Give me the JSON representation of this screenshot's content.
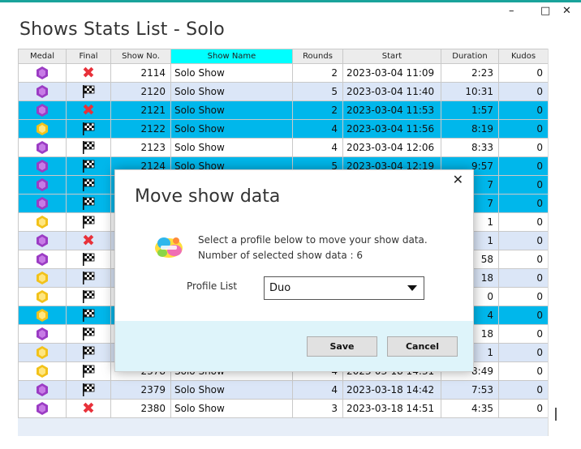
{
  "window": {
    "title": "Shows Stats List - Solo",
    "minimize_glyph": "–",
    "maximize_glyph": "□",
    "close_glyph": "✕"
  },
  "grid": {
    "columns": [
      "Medal",
      "Final",
      "Show No.",
      "Show Name",
      "Rounds",
      "Start",
      "Duration",
      "Kudos"
    ],
    "active_column": "Show Name",
    "rows": [
      {
        "medal": "purple",
        "final": "x",
        "show_no": "2114",
        "show_name": "Solo Show",
        "rounds": "2",
        "start": "2023-03-04 11:09",
        "duration": "2:23",
        "kudos": "0",
        "state": "white"
      },
      {
        "medal": "purple",
        "final": "flag",
        "show_no": "2120",
        "show_name": "Solo Show",
        "rounds": "5",
        "start": "2023-03-04 11:40",
        "duration": "10:31",
        "kudos": "0",
        "state": "alt"
      },
      {
        "medal": "purple",
        "final": "x",
        "show_no": "2121",
        "show_name": "Solo Show",
        "rounds": "2",
        "start": "2023-03-04 11:53",
        "duration": "1:57",
        "kudos": "0",
        "state": "sel"
      },
      {
        "medal": "gold",
        "final": "flag",
        "show_no": "2122",
        "show_name": "Solo Show",
        "rounds": "4",
        "start": "2023-03-04 11:56",
        "duration": "8:19",
        "kudos": "0",
        "state": "sel"
      },
      {
        "medal": "purple",
        "final": "flag",
        "show_no": "2123",
        "show_name": "Solo Show",
        "rounds": "4",
        "start": "2023-03-04 12:06",
        "duration": "8:33",
        "kudos": "0",
        "state": "white"
      },
      {
        "medal": "purple",
        "final": "flag",
        "show_no": "2124",
        "show_name": "Solo Show",
        "rounds": "5",
        "start": "2023-03-04 12:19",
        "duration": "9:57",
        "kudos": "0",
        "state": "sel"
      },
      {
        "medal": "purple",
        "final": "flag",
        "show_no": "",
        "show_name": "",
        "rounds": "",
        "start": "",
        "duration": "7",
        "kudos": "0",
        "state": "sel"
      },
      {
        "medal": "purple",
        "final": "flag",
        "show_no": "",
        "show_name": "",
        "rounds": "",
        "start": "",
        "duration": "7",
        "kudos": "0",
        "state": "sel"
      },
      {
        "medal": "gold",
        "final": "flag",
        "show_no": "",
        "show_name": "",
        "rounds": "",
        "start": "",
        "duration": "1",
        "kudos": "0",
        "state": "white"
      },
      {
        "medal": "purple",
        "final": "x",
        "show_no": "",
        "show_name": "",
        "rounds": "",
        "start": "",
        "duration": "1",
        "kudos": "0",
        "state": "alt"
      },
      {
        "medal": "purple",
        "final": "flag",
        "show_no": "",
        "show_name": "",
        "rounds": "",
        "start": "",
        "duration": "58",
        "kudos": "0",
        "state": "white"
      },
      {
        "medal": "gold",
        "final": "flag",
        "show_no": "",
        "show_name": "",
        "rounds": "",
        "start": "",
        "duration": "18",
        "kudos": "0",
        "state": "alt"
      },
      {
        "medal": "gold",
        "final": "flag",
        "show_no": "",
        "show_name": "",
        "rounds": "",
        "start": "",
        "duration": "0",
        "kudos": "0",
        "state": "white"
      },
      {
        "medal": "gold",
        "final": "flag",
        "show_no": "",
        "show_name": "",
        "rounds": "",
        "start": "",
        "duration": "4",
        "kudos": "0",
        "state": "sel"
      },
      {
        "medal": "purple",
        "final": "flag",
        "show_no": "",
        "show_name": "",
        "rounds": "",
        "start": "",
        "duration": "18",
        "kudos": "0",
        "state": "white"
      },
      {
        "medal": "gold",
        "final": "flag",
        "show_no": "",
        "show_name": "",
        "rounds": "",
        "start": "",
        "duration": "1",
        "kudos": "0",
        "state": "alt"
      },
      {
        "medal": "gold",
        "final": "flag",
        "show_no": "2378",
        "show_name": "Solo Show",
        "rounds": "4",
        "start": "2023-03-18 14:31",
        "duration": "8:49",
        "kudos": "0",
        "state": "white"
      },
      {
        "medal": "purple",
        "final": "flag",
        "show_no": "2379",
        "show_name": "Solo Show",
        "rounds": "4",
        "start": "2023-03-18 14:42",
        "duration": "7:53",
        "kudos": "0",
        "state": "alt"
      },
      {
        "medal": "purple",
        "final": "x",
        "show_no": "2380",
        "show_name": "Solo Show",
        "rounds": "3",
        "start": "2023-03-18 14:51",
        "duration": "4:35",
        "kudos": "0",
        "state": "white"
      }
    ]
  },
  "dialog": {
    "title": "Move show data",
    "close_glyph": "✕",
    "logo_icon": "fall-guys-logo",
    "message_line1": "Select a profile below to move your show data.",
    "message_line2": "Number of selected show data : 6",
    "profile_label": "Profile List",
    "profile_selected": "Duo",
    "save_label": "Save",
    "cancel_label": "Cancel"
  },
  "colors": {
    "selected_row": "#00b7eb",
    "alt_row": "#dbe6f7",
    "active_header": "#00ffff",
    "medal_purple": "#9b3cc4",
    "medal_gold": "#f2c21a",
    "fail_x": "#e8313a",
    "dialog_footer": "#def4fa"
  }
}
